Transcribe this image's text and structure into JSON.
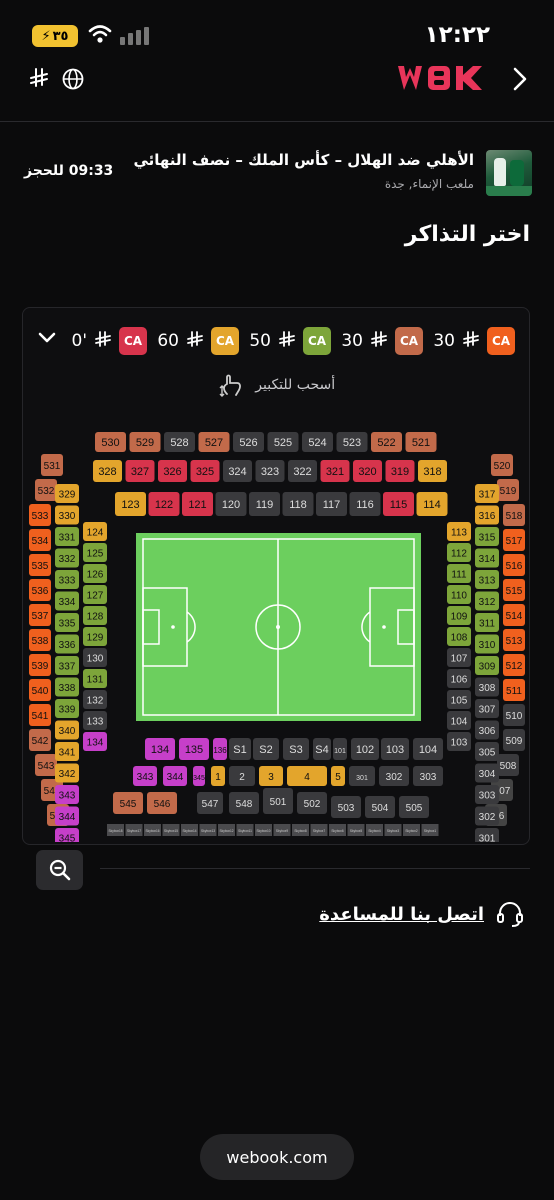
{
  "status": {
    "time": "١٢:٢٢",
    "battery": "٣٥"
  },
  "header": {
    "logo": "WBK"
  },
  "event": {
    "title": "الأهلي ضد الهلال – كأس الملك – نصف النهائي",
    "venue": "ملعب الإنماء, جدة",
    "timer": "09:33 للحجز"
  },
  "page": {
    "section_title": "اختر التذاكر"
  },
  "prices": [
    {
      "label": "CA",
      "amount": "30",
      "color": "#f0601e"
    },
    {
      "label": "CA",
      "amount": "30",
      "color": "#c26a4a"
    },
    {
      "label": "CA",
      "amount": "50",
      "color": "#7da53a"
    },
    {
      "label": "CA",
      "amount": "60",
      "color": "#e3a52c"
    },
    {
      "label": "CA",
      "amount": "0'",
      "color": "#d7344c"
    }
  ],
  "map": {
    "drag_hint": "أسحب للتكبير",
    "top_row": [
      "530",
      "529",
      "528",
      "527",
      "526",
      "525",
      "524",
      "523",
      "522",
      "521"
    ],
    "row3_top": [
      "328",
      "327",
      "326",
      "325",
      "324",
      "323",
      "322",
      "321",
      "320",
      "319",
      "318"
    ],
    "row1_top": [
      "123",
      "122",
      "121",
      "120",
      "119",
      "118",
      "117",
      "116",
      "115",
      "114"
    ],
    "left_500": [
      "531",
      "532",
      "533",
      "534",
      "535",
      "536",
      "537",
      "538",
      "539",
      "540",
      "541",
      "542",
      "543",
      "544",
      "545"
    ],
    "left_300": [
      "329",
      "330",
      "331",
      "332",
      "333",
      "334",
      "335",
      "336",
      "337",
      "338",
      "339",
      "340",
      "341",
      "342",
      "343",
      "344",
      "345"
    ],
    "left_100": [
      "124",
      "125",
      "126",
      "127",
      "128",
      "129",
      "130",
      "131",
      "132",
      "133",
      "134",
      "135",
      "136"
    ],
    "right_500": [
      "520",
      "519",
      "518",
      "517",
      "516",
      "515",
      "514",
      "513",
      "512",
      "511",
      "510",
      "509",
      "508",
      "507",
      "506"
    ],
    "right_300": [
      "317",
      "316",
      "315",
      "314",
      "313",
      "312",
      "311",
      "310",
      "309",
      "308",
      "307",
      "306",
      "305",
      "304",
      "303",
      "302",
      "301"
    ],
    "right_100": [
      "113",
      "112",
      "111",
      "110",
      "109",
      "108",
      "107",
      "106",
      "105",
      "104",
      "103",
      "102",
      "101"
    ],
    "bottom_sections": [
      "S1",
      "S2",
      "S3",
      "S4",
      "1",
      "2",
      "3",
      "4",
      "5",
      "501",
      "502",
      "503",
      "504",
      "505",
      "546",
      "547",
      "548"
    ],
    "skyboxes": [
      "Skybox18",
      "Skybox17",
      "Skybox16",
      "Skybox15",
      "Skybox14",
      "Skybox13",
      "Skybox12",
      "Skybox11",
      "Skybox10",
      "Skybox9",
      "Skybox8",
      "Skybox7",
      "Skybox6",
      "Skybox5",
      "Skybox4",
      "Skybox3",
      "Skybox2",
      "Skybox1"
    ]
  },
  "help": {
    "label": "اتصل بنا للمساعدة"
  },
  "footer": {
    "url": "webook.com"
  }
}
